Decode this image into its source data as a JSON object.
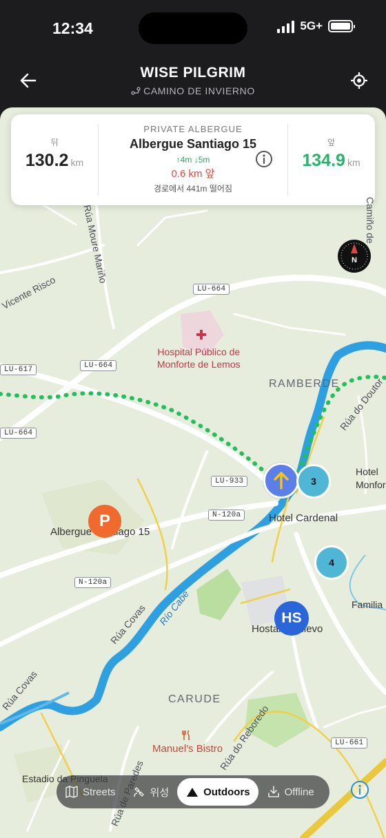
{
  "status_bar": {
    "time": "12:34",
    "network": "5G+"
  },
  "header": {
    "title": "WISE PILGRIM",
    "subtitle": "CAMINO DE INVIERNO"
  },
  "card": {
    "behind_label": "뒤",
    "behind_value": "130.2",
    "behind_unit": "km",
    "kind": "PRIVATE ALBERGUE",
    "name": "Albergue Santiago 15",
    "elevation": "↑4m ↓5m",
    "ahead_distance": "0.6 km 앞",
    "off_route": "경로에서 441m 떨어짐",
    "ahead_label": "앞",
    "ahead_value": "134.9",
    "ahead_unit": "km"
  },
  "compass": {
    "label": "N"
  },
  "map_labels": {
    "hospital": "Hospital Público de\nMonforte de Lemos",
    "ramberde": "RAMBERDE",
    "carude": "CARUDE",
    "hotel_cardenal": "Hotel Cardenal",
    "hostal_medievo": "Hostal Medievo",
    "albergue": "Albergue Santiago 15",
    "manuels": "Manuel's Bistro",
    "estadio": "Estadio da Pinguela",
    "familia": "Familia",
    "hotel_monfor": "Hotel\nMonfor",
    "rua_moure": "Rúa Moure Mariño",
    "vicente_risco": "Vicente Risco",
    "camino_de": "Camiño de",
    "rua_covas_1": "Rúa Covas",
    "rua_covas_2": "Rúa Covas",
    "rio_cabe": "Río Cabe",
    "rua_reboredo": "Rúa do Reboredo",
    "rua_paredes": "Rúa de Paredes",
    "rua_doutor": "Rúa do Doutor"
  },
  "road_shields": [
    "LU-664",
    "LU-664",
    "LU-617",
    "LU-664",
    "LU-933",
    "N-120a",
    "N-120a",
    "LU-661"
  ],
  "markers": {
    "cluster_a": "3",
    "cluster_b": "4",
    "parking": "P",
    "hostal": "HS"
  },
  "tabs": [
    {
      "label": "Streets",
      "icon": "map-icon",
      "active": false
    },
    {
      "label": "위성",
      "icon": "satellite-icon",
      "active": false
    },
    {
      "label": "Outdoors",
      "icon": "mountain-icon",
      "active": true
    },
    {
      "label": "Offline",
      "icon": "download-icon",
      "active": false
    }
  ],
  "colors": {
    "header_bg": "#1c1c1e",
    "map_bg": "#e7eddc",
    "route": "#21c05a",
    "river": "#2e9fe0",
    "ahead": "#27b36a",
    "warning": "#e0463d"
  }
}
